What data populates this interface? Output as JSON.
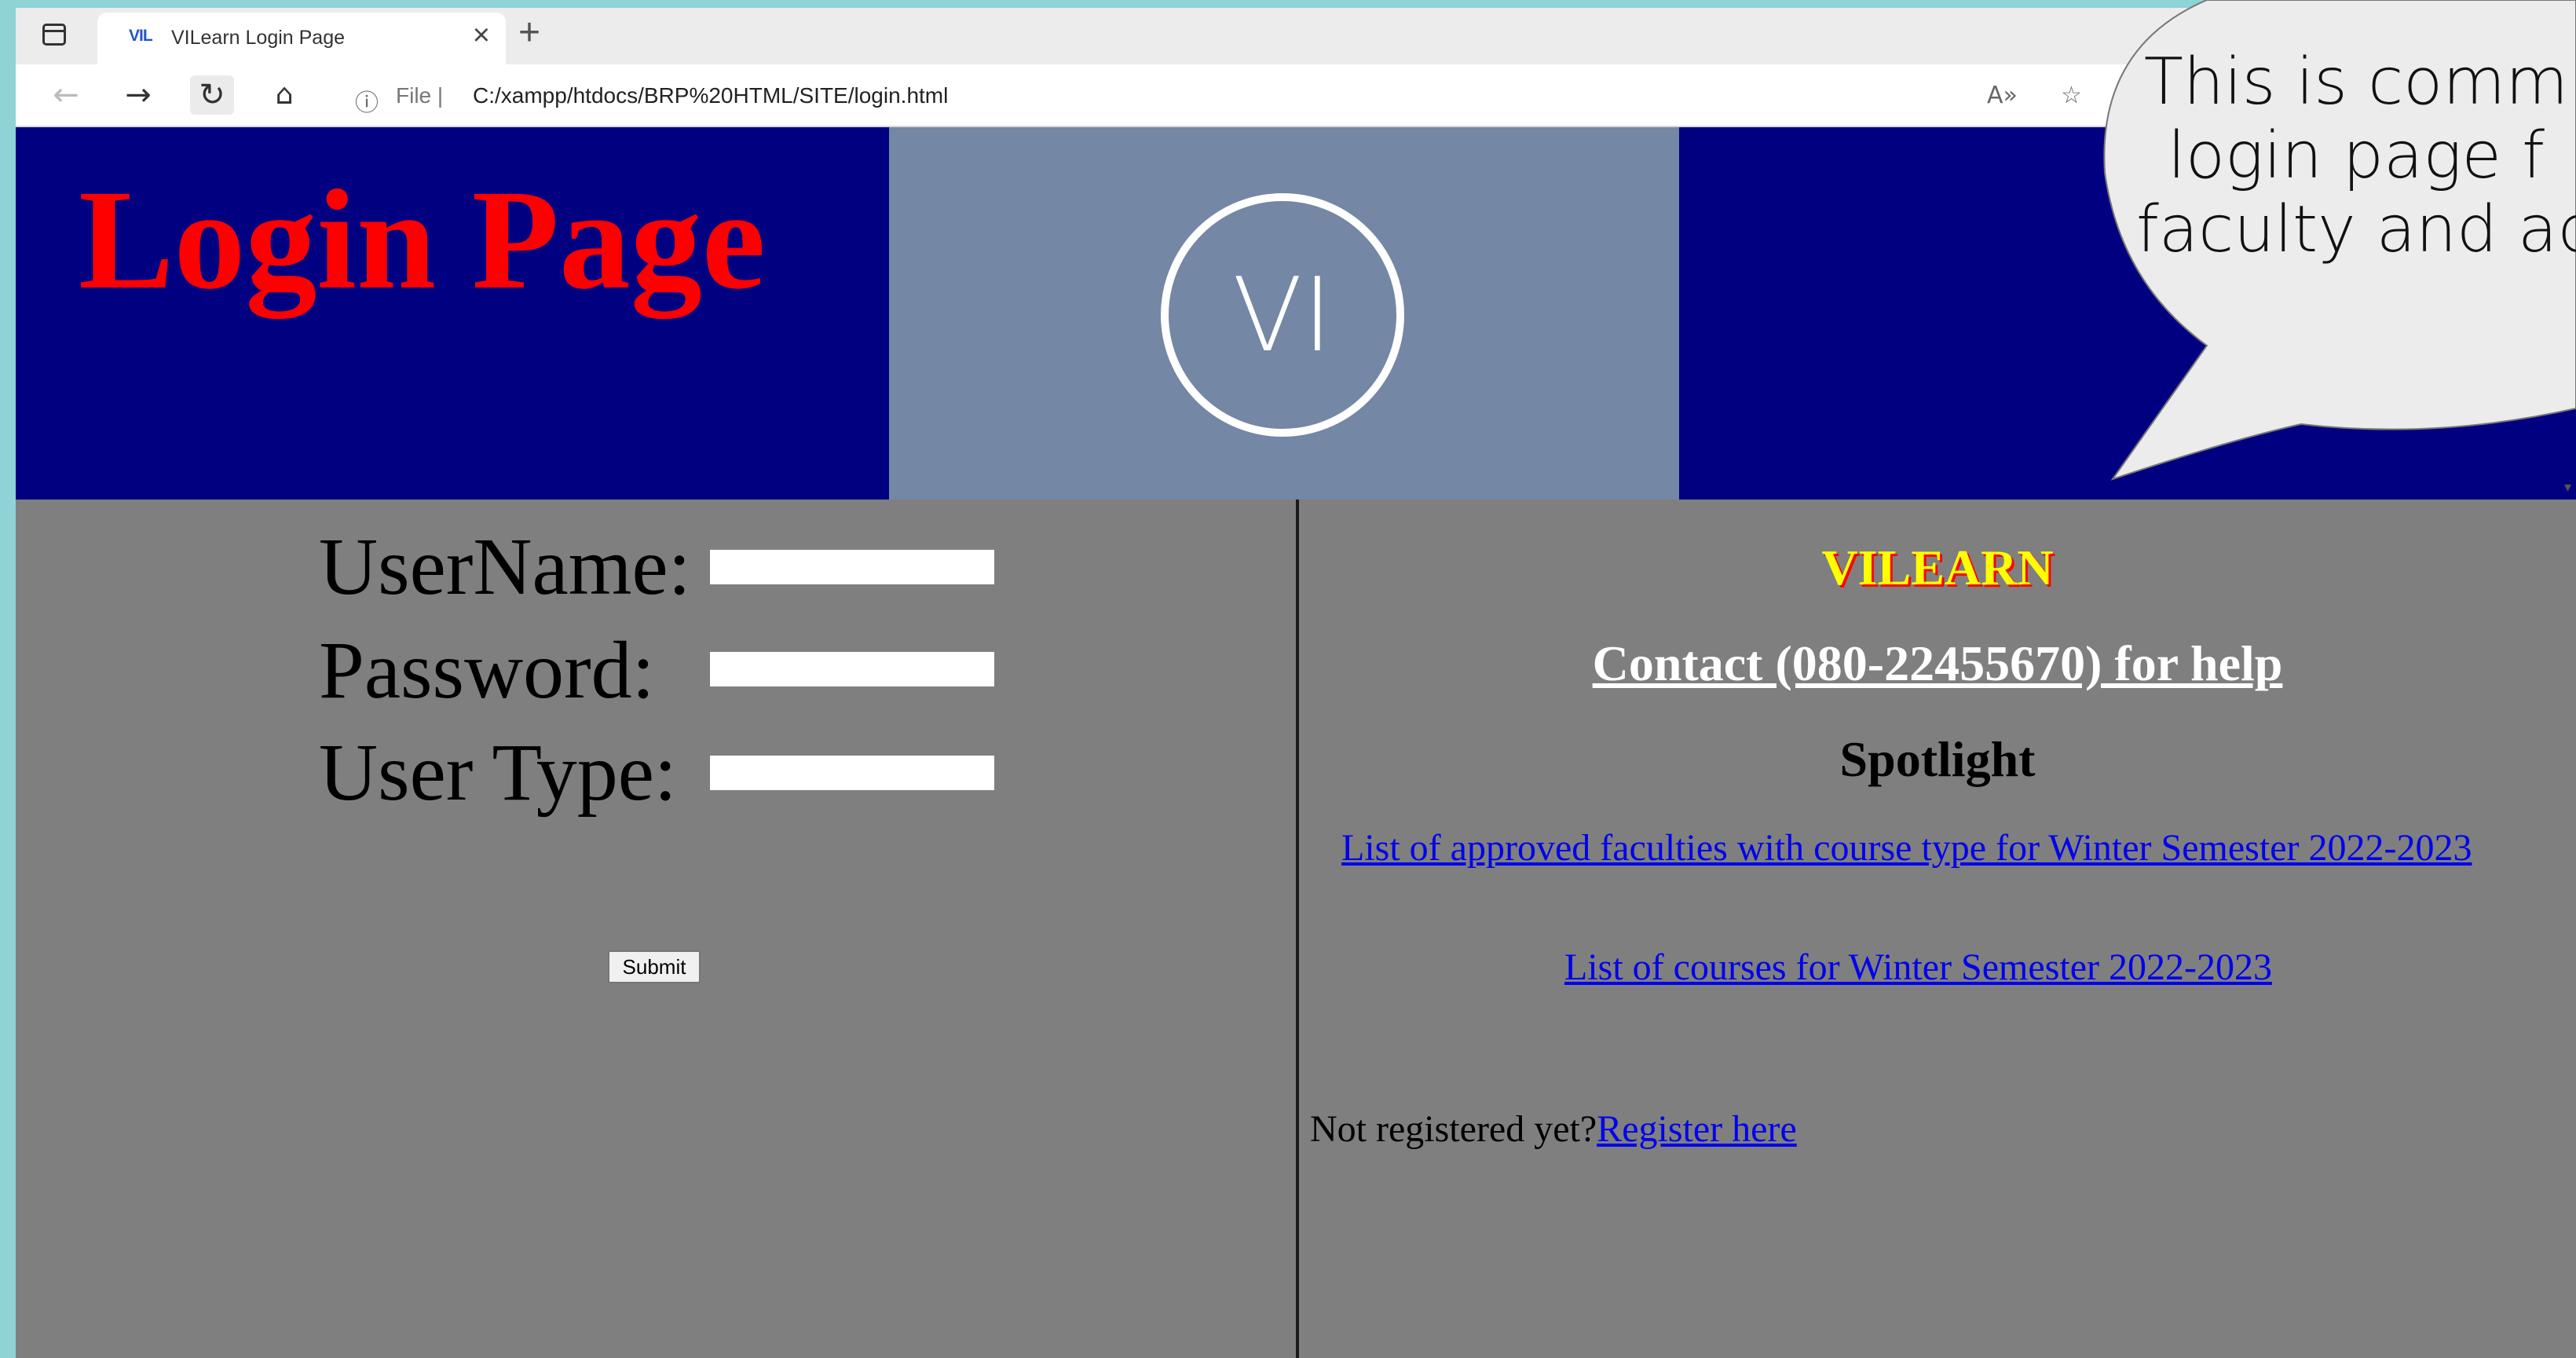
{
  "browser": {
    "tab_title": "VILearn Login Page",
    "tab_favicon": "VIL",
    "tab_close": "×",
    "new_tab": "+",
    "nav": {
      "back": "←",
      "forward": "→",
      "reload": "↻",
      "home": "⌂"
    },
    "info_icon": "ⓘ",
    "url_scheme": "File |",
    "url": "C:/xampp/htdocs/BRP%20HTML/SITE/login.html",
    "read_aloud_icon": "A»",
    "favorites_icon": "☆"
  },
  "banner": {
    "title": "Login Page",
    "logo_text": "VI",
    "colors": {
      "left": "#000080",
      "middle": "#7487a4",
      "right": "#000080",
      "title": "#ff0000"
    }
  },
  "form": {
    "username_label": "UserName:",
    "password_label": "Password:",
    "usertype_label": "User Type:",
    "submit_label": "Submit"
  },
  "sidebar": {
    "brand": "VILEARN",
    "contact": "Contact (080-22455670) for help",
    "spotlight_heading": "Spotlight",
    "links": [
      "List of approved faculties with course type for Winter Semester 2022-2023",
      "List of courses for Winter Semester 2022-2023"
    ],
    "register_prompt": "Not registered yet?",
    "register_link": "Register here"
  },
  "callout": {
    "lines": [
      "This is comm",
      "login page f",
      "faculty and ad"
    ]
  },
  "colors": {
    "page_background": "#7f7f7f",
    "outer_background": "#8fd3d6",
    "link": "#0000ee",
    "brand_text": "#ffff00",
    "brand_shadow": "#ff0000"
  }
}
